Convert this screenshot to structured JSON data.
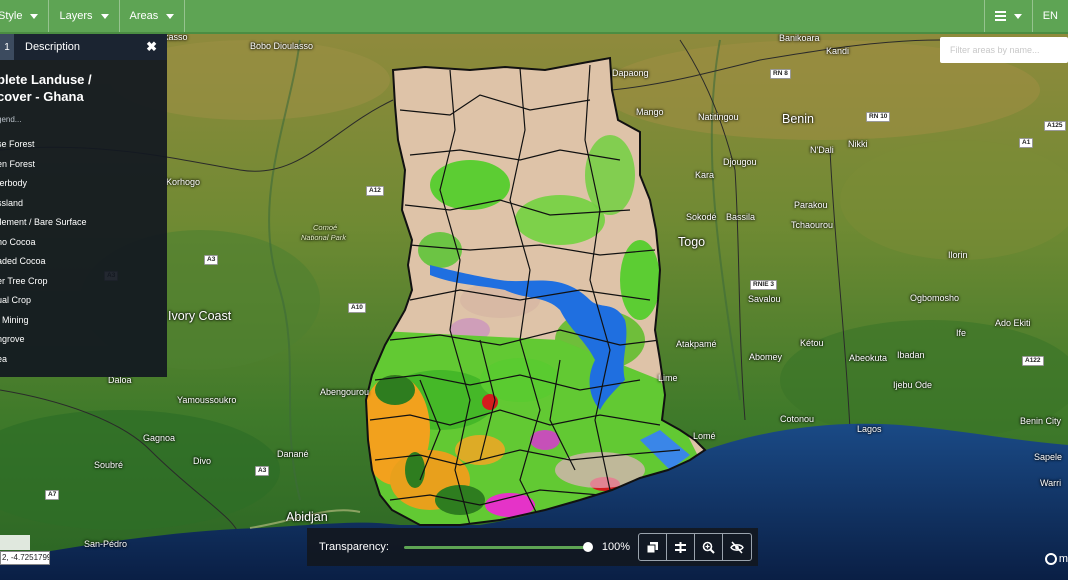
{
  "toolbar": {
    "style_label": "Style",
    "layers_label": "Layers",
    "areas_label": "Areas",
    "language_label": "EN"
  },
  "panel": {
    "tab_active_label": "1",
    "tab_description_label": "Description",
    "title_line1": "plete Landuse /",
    "title_line2": "cover - Ghana",
    "legend_heading": "gend...",
    "legend_items": [
      "se Forest",
      "en Forest",
      "terbody",
      "ssland",
      "tlement / Bare Surface",
      "no Cocoa",
      "aded Cocoa",
      "er Tree Crop",
      "ual Crop",
      "t Mining",
      "ngrove",
      "ea"
    ]
  },
  "search": {
    "placeholder": "Filter areas by name..."
  },
  "transparency": {
    "label": "Transparency:",
    "value_label": "100%",
    "value": 1.0
  },
  "coordinates": {
    "text": "2, -4.7251799"
  },
  "attribution": {
    "label": "m"
  },
  "places": {
    "bobo_dioulasso": "Bobo Dioulasso",
    "kasso": "ikasso",
    "banikoara": "Banikoara",
    "kandi": "Kandi",
    "dapaong": "Dapaong",
    "mango": "Mango",
    "natitingou": "Natitingou",
    "benin": "Benin",
    "djougou": "Djougou",
    "ndali": "N'Dali",
    "nikki": "Nikki",
    "kara": "Kara",
    "korhogo": "Korhogo",
    "comoe": "Comoé",
    "comoe_park": "National Park",
    "sokode": "Sokodé",
    "bassila": "Bassila",
    "parakou": "Parakou",
    "tchaourou": "Tchaourou",
    "togo": "Togo",
    "ilorin": "Ilorin",
    "savalou": "Savalou",
    "ogbomosho": "Ogbomosho",
    "ivory_coast": "Ivory Coast",
    "ife": "Ife",
    "ado_ekiti": "Ado Ekiti",
    "atakpame": "Atakpamé",
    "abomey": "Abomey",
    "ketou": "Kétou",
    "abeokuta": "Abeokuta",
    "ibadan": "Ibadan",
    "daloa": "Daloa",
    "lime": "Lime",
    "ijebu_ode": "Ijebu Ode",
    "abengourou": "Abengourou",
    "yamoussoukro": "Yamoussoukro",
    "cotonou": "Cotonou",
    "lome": "Lomé",
    "lagos": "Lagos",
    "benin_city": "Benin City",
    "gagnoa": "Gagnoa",
    "divo": "Divo",
    "soubre": "Soubré",
    "danane": "Danané",
    "sapele": "Sapele",
    "warri": "Warri",
    "abidjan": "Abidjan",
    "san_pedro": "San-Pédro"
  },
  "roads": {
    "a12": "A12",
    "a3_a": "A3",
    "a10": "A10",
    "a3_b": "A3",
    "a7": "A7",
    "a3_c": "A3",
    "rn8": "RN 8",
    "rn10": "RN 10",
    "a125": "A125",
    "a1": "A1",
    "rnie3": "RNIE 3",
    "a122": "A122"
  },
  "colors": {
    "toolbar": "#5ea454",
    "panel": "#121820",
    "savanna": "#d9c2a6",
    "open_forest": "#57c22f",
    "dense_forest": "#2e7d1f",
    "waterbody": "#1f6fe0",
    "cocoa": "#f2a11d",
    "mining": "#e533c8",
    "settlement": "#d41d1d",
    "ocean": "#0f2a55"
  }
}
